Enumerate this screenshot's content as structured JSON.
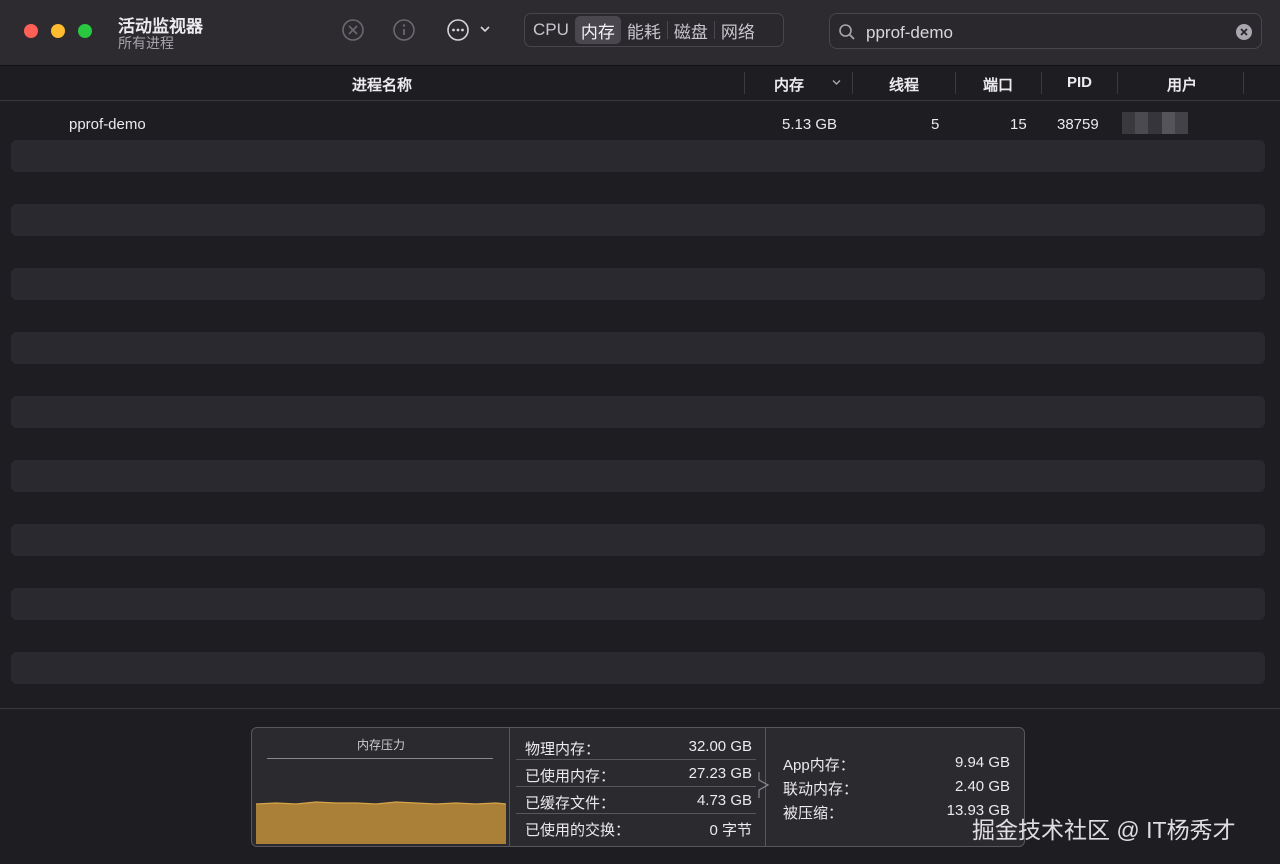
{
  "window": {
    "title": "活动监视器",
    "subtitle": "所有进程"
  },
  "toolbar": {
    "stop_icon": "stop-process-icon",
    "info_icon": "info-icon",
    "more_icon": "more-options-icon",
    "tabs": [
      {
        "label": "CPU",
        "active": false
      },
      {
        "label": "内存",
        "active": true
      },
      {
        "label": "能耗",
        "active": false
      },
      {
        "label": "磁盘",
        "active": false
      },
      {
        "label": "网络",
        "active": false
      }
    ]
  },
  "search": {
    "value": "pprof-demo"
  },
  "table": {
    "columns": {
      "name": "进程名称",
      "memory": "内存",
      "threads": "线程",
      "ports": "端口",
      "pid": "PID",
      "user": "用户"
    },
    "rows": [
      {
        "name": "pprof-demo",
        "memory": "5.13 GB",
        "threads": "5",
        "ports": "15",
        "pid": "38759",
        "user": ""
      }
    ]
  },
  "stats": {
    "pressure_title": "内存压力",
    "pressure_color": "#b88a3a",
    "physical": {
      "label": "物理内存：",
      "value": "32.00 GB"
    },
    "used": {
      "label": "已使用内存：",
      "value": "27.23 GB"
    },
    "cached": {
      "label": "已缓存文件：",
      "value": "4.73 GB"
    },
    "swap": {
      "label": "已使用的交换：",
      "value": "0 字节"
    },
    "app": {
      "label": "App内存：",
      "value": "9.94 GB"
    },
    "wired": {
      "label": "联动内存：",
      "value": "2.40 GB"
    },
    "compressed": {
      "label": "被压缩：",
      "value": "13.93 GB"
    }
  },
  "watermark": "掘金技术社区 @ IT杨秀才"
}
